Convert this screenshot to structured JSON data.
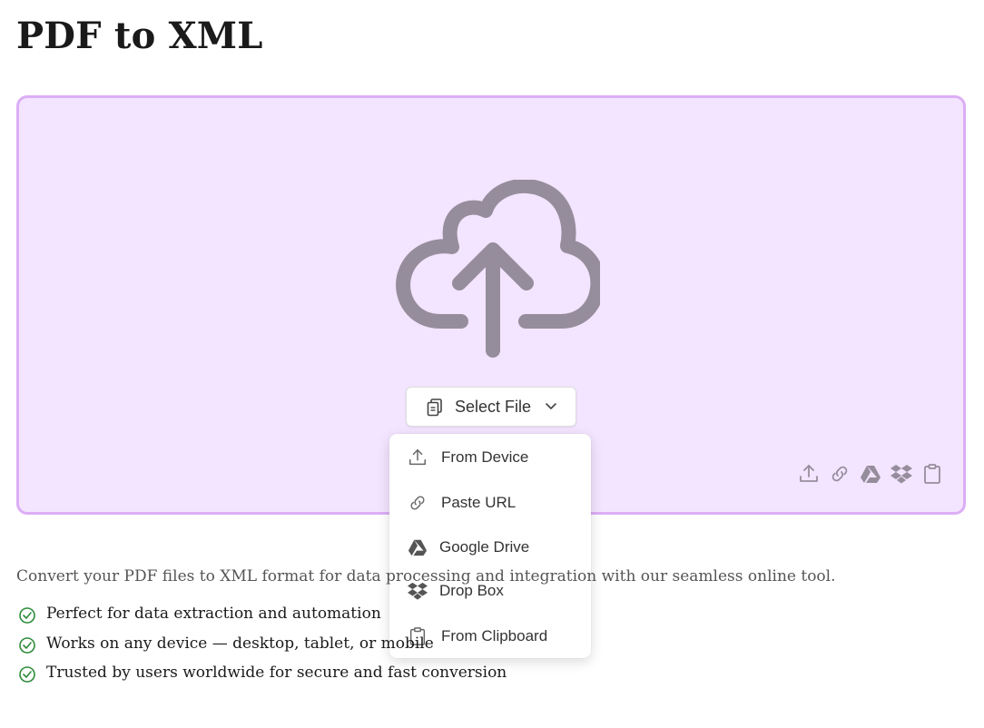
{
  "page": {
    "title": "PDF to XML"
  },
  "uploader": {
    "select_label": "Select File",
    "menu": [
      {
        "label": "From Device",
        "icon": "upload-icon"
      },
      {
        "label": "Paste URL",
        "icon": "link-icon"
      },
      {
        "label": "Google Drive",
        "icon": "google-drive-icon"
      },
      {
        "label": "Drop Box",
        "icon": "dropbox-icon"
      },
      {
        "label": "From Clipboard",
        "icon": "clipboard-icon"
      }
    ],
    "quick_icons": [
      "upload-icon",
      "link-icon",
      "google-drive-icon",
      "dropbox-icon",
      "clipboard-icon"
    ]
  },
  "description": "Convert your PDF files to XML format for data processing and integration with our seamless online tool.",
  "features": [
    "Perfect for data extraction and automation",
    "Works on any device — desktop, tablet, or mobile",
    "Trusted by users worldwide for secure and fast conversion"
  ],
  "colors": {
    "dropzone_bg": "#f3e4ff",
    "dropzone_border": "#dcaef5",
    "icon_gray": "#968d9c",
    "check_green": "#2e8b3a"
  }
}
